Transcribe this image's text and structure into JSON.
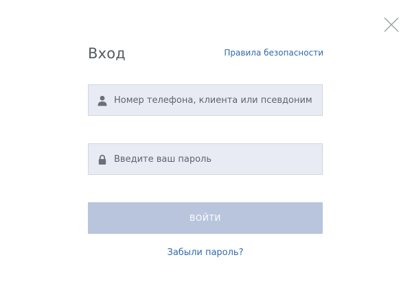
{
  "dialog": {
    "title": "Вход",
    "security_link": "Правила безопасности",
    "close_icon": "close-icon"
  },
  "login_field": {
    "placeholder": "Номер телефона, клиента или псевдоним",
    "value": "",
    "icon": "user-icon"
  },
  "password_field": {
    "placeholder": "Введите ваш пароль",
    "value": "",
    "icon": "lock-icon"
  },
  "submit_button": {
    "label": "войти"
  },
  "forgot_link": {
    "label": "Забыли пароль?"
  },
  "colors": {
    "link": "#2f6aaa",
    "field_bg": "#e8ebf3",
    "button_bg": "#b8c5dc",
    "title": "#555a60"
  }
}
